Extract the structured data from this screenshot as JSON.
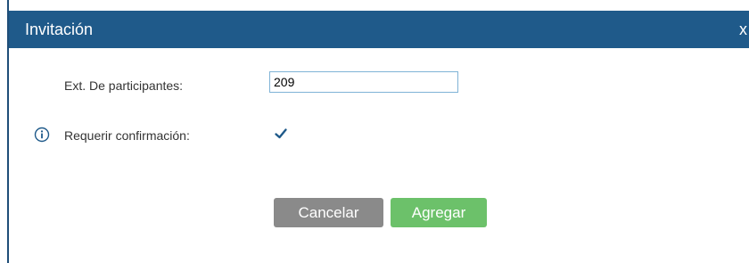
{
  "dialog": {
    "title": "Invitación",
    "close_label": "x"
  },
  "form": {
    "ext_label": "Ext. De participantes:",
    "ext_value": "209",
    "confirm_label": "Requerir confirmación:",
    "confirm_checked": true
  },
  "buttons": {
    "cancel_label": "Cancelar",
    "add_label": "Agregar"
  },
  "colors": {
    "titlebar": "#1f5a8a",
    "input_border": "#7fb3d6",
    "cancel_button": "#8a8a8a",
    "add_button": "#6cc16a",
    "checkmark": "#1f5a8a"
  },
  "icons": {
    "info": "info-circle-icon",
    "check": "checkmark-icon"
  }
}
